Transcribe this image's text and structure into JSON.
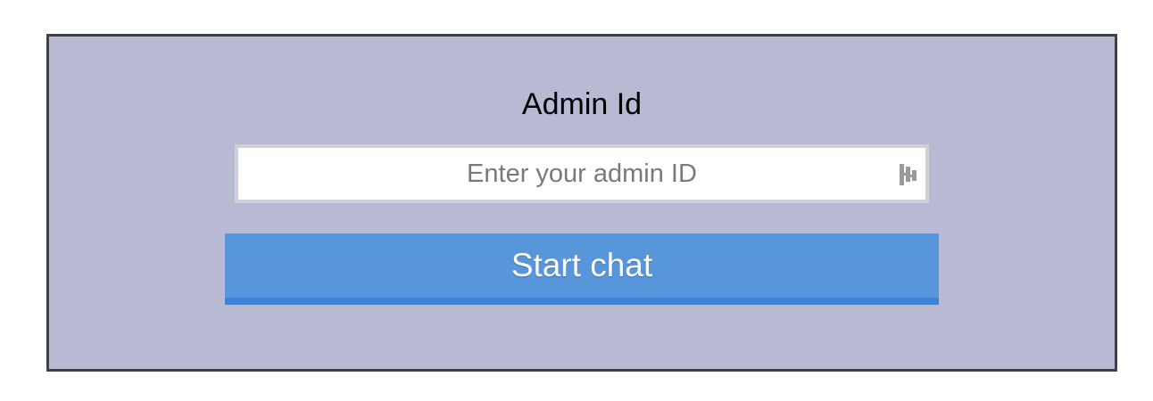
{
  "form": {
    "label": "Admin Id",
    "admin_id_input": {
      "value": "",
      "placeholder": "Enter your admin ID",
      "icon": "password-manager-icon"
    },
    "start_button_label": "Start chat"
  },
  "colors": {
    "panel_background": "#b8b9d3",
    "panel_border": "#3f3f48",
    "button_background": "#5896dc",
    "button_underline": "#3b83d8"
  }
}
